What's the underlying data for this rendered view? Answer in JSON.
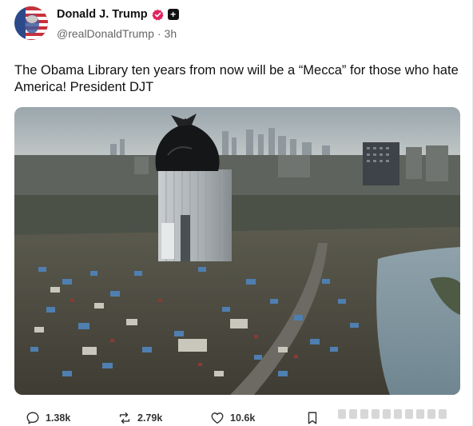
{
  "author": {
    "display_name": "Donald J. Trump",
    "handle": "@realDonaldTrump",
    "separator": "·",
    "time_ago": "3h",
    "verified_icon": "verified-badge-icon",
    "plus_icon": "plus-badge-icon"
  },
  "post": {
    "text": "The Obama Library ten years from now will be a “Mecca” for those who hate America! President DJT",
    "image_icon": "post-image"
  },
  "actions": {
    "replies": "1.38k",
    "reposts": "2.79k",
    "likes": "10.6k"
  },
  "colors": {
    "verified": "#e0245e",
    "text_primary": "#111111",
    "text_secondary": "#666666"
  }
}
